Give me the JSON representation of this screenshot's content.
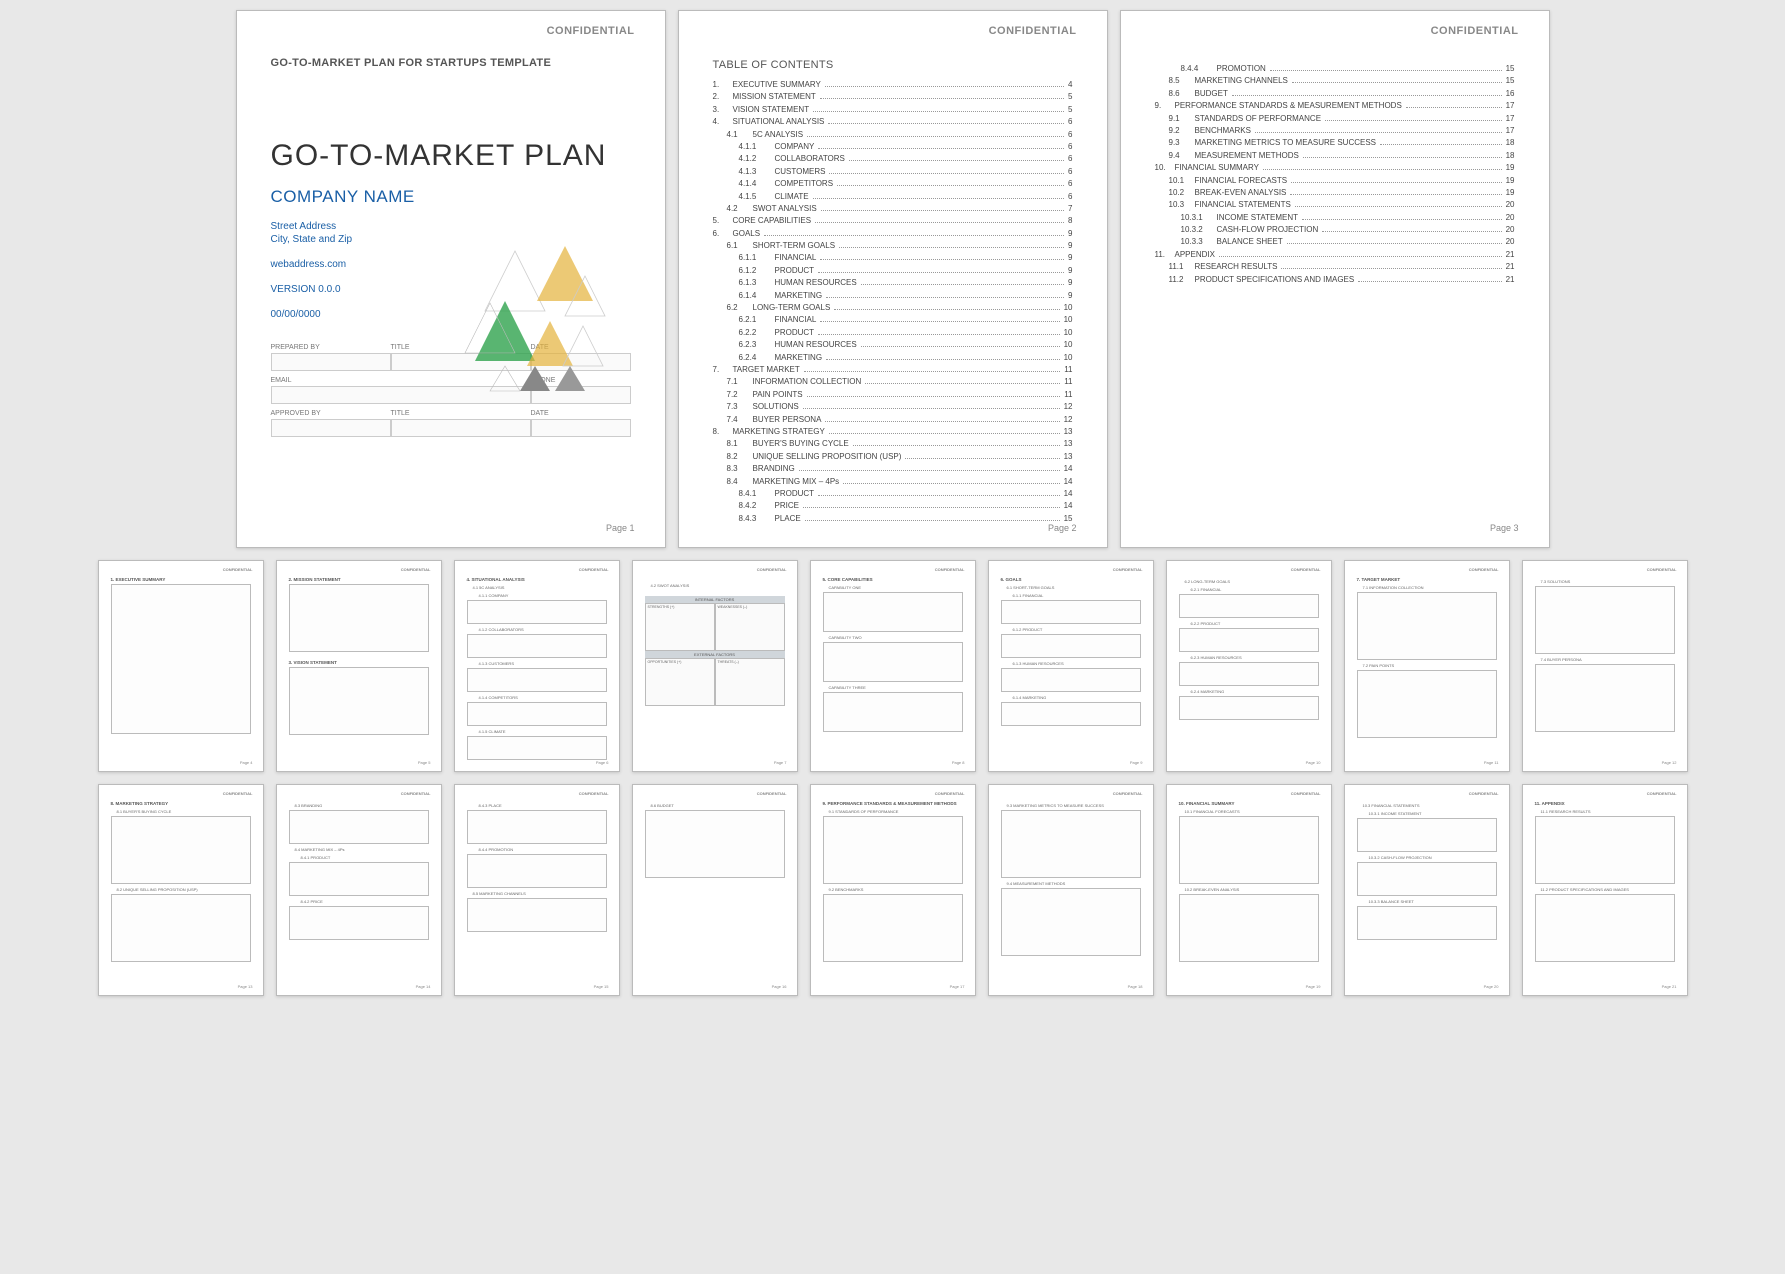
{
  "confidential": "CONFIDENTIAL",
  "cover": {
    "subtitle": "GO-TO-MARKET PLAN FOR STARTUPS TEMPLATE",
    "title": "GO-TO-MARKET PLAN",
    "company": "COMPANY NAME",
    "street": "Street Address",
    "citystate": "City, State and Zip",
    "web": "webaddress.com",
    "version": "VERSION 0.0.0",
    "date": "00/00/0000",
    "form": {
      "prepared": "PREPARED BY",
      "title": "TITLE",
      "date_lbl": "DATE",
      "email": "EMAIL",
      "phone": "PHONE",
      "approved": "APPROVED BY"
    }
  },
  "toc_title": "TABLE OF CONTENTS",
  "toc2": [
    {
      "n": "1.",
      "t": "EXECUTIVE SUMMARY",
      "p": "4",
      "i": 0
    },
    {
      "n": "2.",
      "t": "MISSION STATEMENT",
      "p": "5",
      "i": 0
    },
    {
      "n": "3.",
      "t": "VISION STATEMENT",
      "p": "5",
      "i": 0
    },
    {
      "n": "4.",
      "t": "SITUATIONAL ANALYSIS",
      "p": "6",
      "i": 0
    },
    {
      "n": "4.1",
      "t": "5C ANALYSIS",
      "p": "6",
      "i": 1
    },
    {
      "n": "4.1.1",
      "t": "COMPANY",
      "p": "6",
      "i": 2
    },
    {
      "n": "4.1.2",
      "t": "COLLABORATORS",
      "p": "6",
      "i": 2
    },
    {
      "n": "4.1.3",
      "t": "CUSTOMERS",
      "p": "6",
      "i": 2
    },
    {
      "n": "4.1.4",
      "t": "COMPETITORS",
      "p": "6",
      "i": 2
    },
    {
      "n": "4.1.5",
      "t": "CLIMATE",
      "p": "6",
      "i": 2
    },
    {
      "n": "4.2",
      "t": "SWOT ANALYSIS",
      "p": "7",
      "i": 1
    },
    {
      "n": "5.",
      "t": "CORE CAPABILITIES",
      "p": "8",
      "i": 0
    },
    {
      "n": "6.",
      "t": "GOALS",
      "p": "9",
      "i": 0
    },
    {
      "n": "6.1",
      "t": "SHORT-TERM GOALS",
      "p": "9",
      "i": 1
    },
    {
      "n": "6.1.1",
      "t": "FINANCIAL",
      "p": "9",
      "i": 2
    },
    {
      "n": "6.1.2",
      "t": "PRODUCT",
      "p": "9",
      "i": 2
    },
    {
      "n": "6.1.3",
      "t": "HUMAN RESOURCES",
      "p": "9",
      "i": 2
    },
    {
      "n": "6.1.4",
      "t": "MARKETING",
      "p": "9",
      "i": 2
    },
    {
      "n": "6.2",
      "t": "LONG-TERM GOALS",
      "p": "10",
      "i": 1
    },
    {
      "n": "6.2.1",
      "t": "FINANCIAL",
      "p": "10",
      "i": 2
    },
    {
      "n": "6.2.2",
      "t": "PRODUCT",
      "p": "10",
      "i": 2
    },
    {
      "n": "6.2.3",
      "t": "HUMAN RESOURCES",
      "p": "10",
      "i": 2
    },
    {
      "n": "6.2.4",
      "t": "MARKETING",
      "p": "10",
      "i": 2
    },
    {
      "n": "7.",
      "t": "TARGET MARKET",
      "p": "11",
      "i": 0
    },
    {
      "n": "7.1",
      "t": "INFORMATION COLLECTION",
      "p": "11",
      "i": 1
    },
    {
      "n": "7.2",
      "t": "PAIN POINTS",
      "p": "11",
      "i": 1
    },
    {
      "n": "7.3",
      "t": "SOLUTIONS",
      "p": "12",
      "i": 1
    },
    {
      "n": "7.4",
      "t": "BUYER PERSONA",
      "p": "12",
      "i": 1
    },
    {
      "n": "8.",
      "t": "MARKETING STRATEGY",
      "p": "13",
      "i": 0
    },
    {
      "n": "8.1",
      "t": "BUYER'S BUYING CYCLE",
      "p": "13",
      "i": 1
    },
    {
      "n": "8.2",
      "t": "UNIQUE SELLING PROPOSITION (USP)",
      "p": "13",
      "i": 1
    },
    {
      "n": "8.3",
      "t": "BRANDING",
      "p": "14",
      "i": 1
    },
    {
      "n": "8.4",
      "t": "MARKETING MIX – 4Ps",
      "p": "14",
      "i": 1
    },
    {
      "n": "8.4.1",
      "t": "PRODUCT",
      "p": "14",
      "i": 2
    },
    {
      "n": "8.4.2",
      "t": "PRICE",
      "p": "14",
      "i": 2
    },
    {
      "n": "8.4.3",
      "t": "PLACE",
      "p": "15",
      "i": 2
    }
  ],
  "toc3": [
    {
      "n": "8.4.4",
      "t": "PROMOTION",
      "p": "15",
      "i": 2
    },
    {
      "n": "8.5",
      "t": "MARKETING CHANNELS",
      "p": "15",
      "i": 1
    },
    {
      "n": "8.6",
      "t": "BUDGET",
      "p": "16",
      "i": 1
    },
    {
      "n": "9.",
      "t": "PERFORMANCE STANDARDS & MEASUREMENT METHODS",
      "p": "17",
      "i": 0
    },
    {
      "n": "9.1",
      "t": "STANDARDS OF PERFORMANCE",
      "p": "17",
      "i": 1
    },
    {
      "n": "9.2",
      "t": "BENCHMARKS",
      "p": "17",
      "i": 1
    },
    {
      "n": "9.3",
      "t": "MARKETING METRICS TO MEASURE SUCCESS",
      "p": "18",
      "i": 1
    },
    {
      "n": "9.4",
      "t": "MEASUREMENT METHODS",
      "p": "18",
      "i": 1
    },
    {
      "n": "10.",
      "t": "FINANCIAL SUMMARY",
      "p": "19",
      "i": 0
    },
    {
      "n": "10.1",
      "t": "FINANCIAL FORECASTS",
      "p": "19",
      "i": 1
    },
    {
      "n": "10.2",
      "t": "BREAK-EVEN ANALYSIS",
      "p": "19",
      "i": 1
    },
    {
      "n": "10.3",
      "t": "FINANCIAL STATEMENTS",
      "p": "20",
      "i": 1
    },
    {
      "n": "10.3.1",
      "t": "INCOME STATEMENT",
      "p": "20",
      "i": 2
    },
    {
      "n": "10.3.2",
      "t": "CASH-FLOW PROJECTION",
      "p": "20",
      "i": 2
    },
    {
      "n": "10.3.3",
      "t": "BALANCE SHEET",
      "p": "20",
      "i": 2
    },
    {
      "n": "11.",
      "t": "APPENDIX",
      "p": "21",
      "i": 0
    },
    {
      "n": "11.1",
      "t": "RESEARCH RESULTS",
      "p": "21",
      "i": 1
    },
    {
      "n": "11.2",
      "t": "PRODUCT SPECIFICATIONS AND IMAGES",
      "p": "21",
      "i": 1
    }
  ],
  "pagelabels": {
    "p1": "Page 1",
    "p2": "Page 2",
    "p3": "Page 3"
  },
  "thumbs": {
    "p4": {
      "h": "1. EXECUTIVE SUMMARY",
      "pg": "Page 4"
    },
    "p5": {
      "h1": "2. MISSION STATEMENT",
      "h2": "3. VISION STATEMENT",
      "pg": "Page 5"
    },
    "p6": {
      "h": "4. SITUATIONAL ANALYSIS",
      "s1": "4.1  5C ANALYSIS",
      "a": "4.1.1  COMPANY",
      "b": "4.1.2  COLLABORATORS",
      "c": "4.1.3  CUSTOMERS",
      "d": "4.1.4  COMPETITORS",
      "e": "4.1.5  CLIMATE",
      "pg": "Page 6"
    },
    "p7": {
      "s": "4.2  SWOT ANALYSIS",
      "int": "INTERNAL FACTORS",
      "ext": "EXTERNAL FACTORS",
      "st": "STRENGTHS (+)",
      "wk": "WEAKNESSES (–)",
      "op": "OPPORTUNITIES (+)",
      "th": "THREATS (–)",
      "pg": "Page 7"
    },
    "p8": {
      "h": "5. CORE CAPABILITIES",
      "c1": "CAPABILITY ONE",
      "c2": "CAPABILITY TWO",
      "c3": "CAPABILITY THREE",
      "pg": "Page 8"
    },
    "p9": {
      "h": "6. GOALS",
      "s": "6.1  SHORT-TERM GOALS",
      "a": "6.1.1  FINANCIAL",
      "b": "6.1.2  PRODUCT",
      "c": "6.1.3  HUMAN RESOURCES",
      "d": "6.1.4  MARKETING",
      "pg": "Page 9"
    },
    "p10": {
      "s": "6.2  LONG-TERM GOALS",
      "a": "6.2.1  FINANCIAL",
      "b": "6.2.2  PRODUCT",
      "c": "6.2.3  HUMAN RESOURCES",
      "d": "6.2.4  MARKETING",
      "pg": "Page 10"
    },
    "p11": {
      "h": "7. TARGET MARKET",
      "a": "7.1  INFORMATION COLLECTION",
      "b": "7.2  PAIN POINTS",
      "pg": "Page 11"
    },
    "p12": {
      "a": "7.3  SOLUTIONS",
      "b": "7.4  BUYER PERSONA",
      "pg": "Page 12"
    },
    "p13": {
      "h": "8. MARKETING STRATEGY",
      "a": "8.1  BUYER'S BUYING CYCLE",
      "b": "8.2  UNIQUE SELLING PROPOSITION (USP)",
      "pg": "Page 13"
    },
    "p14": {
      "a": "8.3  BRANDING",
      "b": "8.4  MARKETING MIX – 4Ps",
      "c": "8.4.1  PRODUCT",
      "d": "8.4.2  PRICE",
      "pg": "Page 14"
    },
    "p15": {
      "a": "8.4.3  PLACE",
      "b": "8.4.4  PROMOTION",
      "c": "8.5  MARKETING CHANNELS",
      "pg": "Page 15"
    },
    "p16": {
      "a": "8.6  BUDGET",
      "pg": "Page 16"
    },
    "p17": {
      "h": "9. PERFORMANCE STANDARDS & MEASUREMENT METHODS",
      "a": "9.1  STANDARDS OF PERFORMANCE",
      "b": "9.2  BENCHMARKS",
      "pg": "Page 17"
    },
    "p18": {
      "a": "9.3  MARKETING METRICS TO MEASURE SUCCESS",
      "b": "9.4  MEASUREMENT METHODS",
      "pg": "Page 18"
    },
    "p19": {
      "h": "10. FINANCIAL SUMMARY",
      "a": "10.1  FINANCIAL FORECASTS",
      "b": "10.2  BREAK-EVEN ANALYSIS",
      "pg": "Page 19"
    },
    "p20": {
      "a": "10.3  FINANCIAL STATEMENTS",
      "b": "10.3.1  INCOME STATEMENT",
      "c": "10.3.2  CASH-FLOW PROJECTION",
      "d": "10.3.3  BALANCE SHEET",
      "pg": "Page 20"
    },
    "p21": {
      "h": "11. APPENDIX",
      "a": "11.1  RESEARCH RESULTS",
      "b": "11.2  PRODUCT SPECIFICATIONS AND IMAGES",
      "pg": "Page 21"
    }
  }
}
